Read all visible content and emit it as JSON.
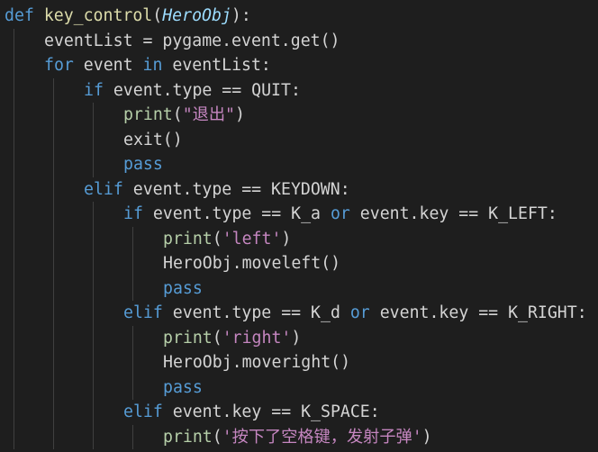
{
  "theme": {
    "background": "#1e1e1e",
    "default_text": "#d4d4d4",
    "keyword": "#569cd6",
    "control_keyword": "#c586c0",
    "function_name": "#dcdcaa",
    "parameter": "#9cdcfe",
    "string": "#ce9178",
    "indent_guide": "#404040"
  },
  "code": {
    "lines": [
      {
        "indent": 0,
        "tokens": [
          {
            "t": "def ",
            "k": "kw"
          },
          {
            "t": "key_control",
            "k": "fn-name"
          },
          {
            "t": "(",
            "k": "plain"
          },
          {
            "t": "HeroObj",
            "k": "param"
          },
          {
            "t": "):",
            "k": "plain"
          }
        ]
      },
      {
        "indent": 1,
        "tokens": [
          {
            "t": "eventList = pygame.event.get()",
            "k": "plain"
          }
        ]
      },
      {
        "indent": 1,
        "tokens": [
          {
            "t": "for",
            "k": "kw"
          },
          {
            "t": " event ",
            "k": "plain"
          },
          {
            "t": "in",
            "k": "kw"
          },
          {
            "t": " eventList:",
            "k": "plain"
          }
        ]
      },
      {
        "indent": 2,
        "tokens": [
          {
            "t": "if",
            "k": "kw"
          },
          {
            "t": " event.type == QUIT:",
            "k": "plain"
          }
        ]
      },
      {
        "indent": 3,
        "tokens": [
          {
            "t": "print",
            "k": "builtin-dim"
          },
          {
            "t": "(",
            "k": "plain"
          },
          {
            "t": "\"退出\"",
            "k": "kw-ctrl"
          },
          {
            "t": ")",
            "k": "plain"
          }
        ]
      },
      {
        "indent": 3,
        "tokens": [
          {
            "t": "exit()",
            "k": "plain"
          }
        ]
      },
      {
        "indent": 3,
        "tokens": [
          {
            "t": "pass",
            "k": "kw"
          }
        ]
      },
      {
        "indent": 2,
        "tokens": [
          {
            "t": "elif",
            "k": "kw"
          },
          {
            "t": " event.type == KEYDOWN:",
            "k": "plain"
          }
        ]
      },
      {
        "indent": 3,
        "tokens": [
          {
            "t": "if",
            "k": "kw"
          },
          {
            "t": " event.type == K_a ",
            "k": "plain"
          },
          {
            "t": "or",
            "k": "kw"
          },
          {
            "t": " event.key == K_LEFT:",
            "k": "plain"
          }
        ]
      },
      {
        "indent": 4,
        "tokens": [
          {
            "t": "print",
            "k": "builtin-dim"
          },
          {
            "t": "(",
            "k": "plain"
          },
          {
            "t": "'left'",
            "k": "kw-ctrl"
          },
          {
            "t": ")",
            "k": "plain"
          }
        ]
      },
      {
        "indent": 4,
        "tokens": [
          {
            "t": "HeroObj.moveleft()",
            "k": "plain"
          }
        ]
      },
      {
        "indent": 4,
        "tokens": [
          {
            "t": "pass",
            "k": "kw"
          }
        ]
      },
      {
        "indent": 3,
        "tokens": [
          {
            "t": "elif",
            "k": "kw"
          },
          {
            "t": " event.type == K_d ",
            "k": "plain"
          },
          {
            "t": "or",
            "k": "kw"
          },
          {
            "t": " event.key == K_RIGHT:",
            "k": "plain"
          }
        ]
      },
      {
        "indent": 4,
        "tokens": [
          {
            "t": "print",
            "k": "builtin-dim"
          },
          {
            "t": "(",
            "k": "plain"
          },
          {
            "t": "'right'",
            "k": "kw-ctrl"
          },
          {
            "t": ")",
            "k": "plain"
          }
        ]
      },
      {
        "indent": 4,
        "tokens": [
          {
            "t": "HeroObj.moveright()",
            "k": "plain"
          }
        ]
      },
      {
        "indent": 4,
        "tokens": [
          {
            "t": "pass",
            "k": "kw"
          }
        ]
      },
      {
        "indent": 3,
        "tokens": [
          {
            "t": "elif",
            "k": "kw"
          },
          {
            "t": " event.key == K_SPACE:",
            "k": "plain"
          }
        ]
      },
      {
        "indent": 4,
        "tokens": [
          {
            "t": "print",
            "k": "builtin-dim"
          },
          {
            "t": "(",
            "k": "plain"
          },
          {
            "t": "'按下了空格键，发射子弹'",
            "k": "kw-ctrl"
          },
          {
            "t": ")",
            "k": "plain"
          }
        ]
      }
    ]
  }
}
